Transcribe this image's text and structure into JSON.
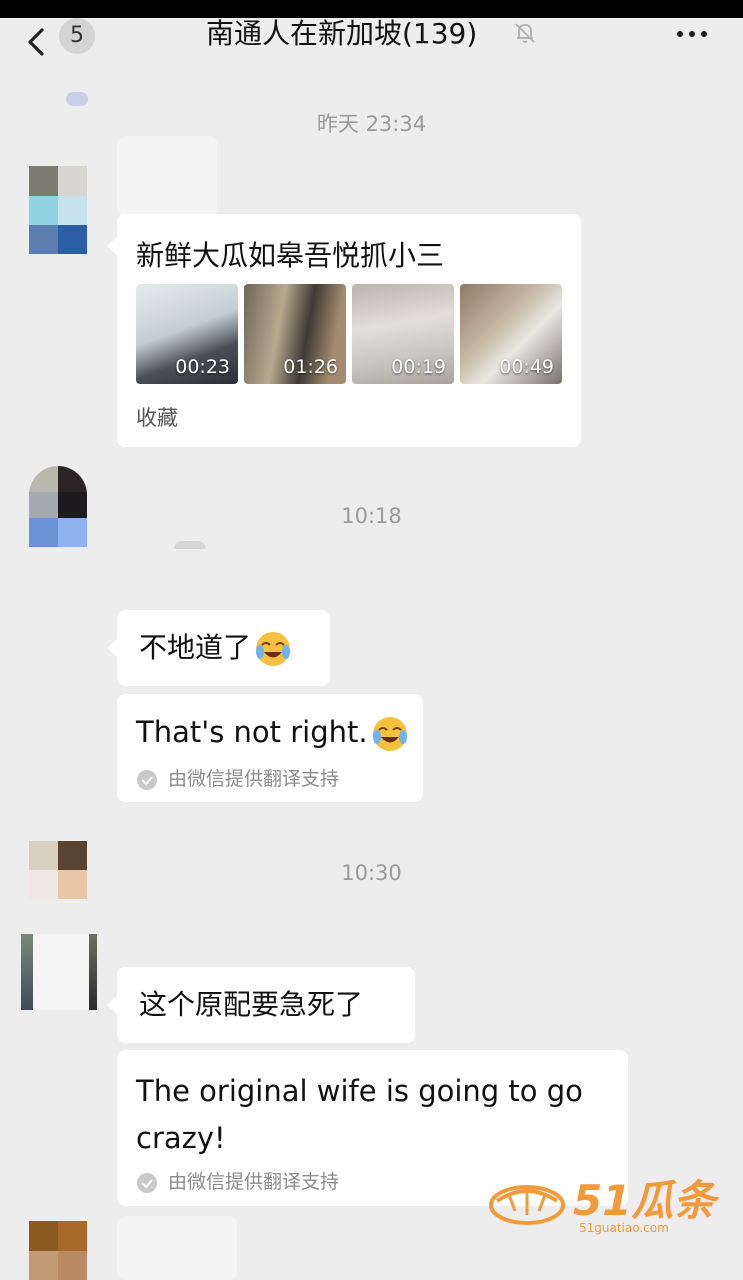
{
  "header": {
    "unread_count": "5",
    "title": "南通人在新加坡(139)",
    "icons": [
      "back-chevron-icon",
      "mute-bell-icon",
      "more-dots-icon"
    ]
  },
  "messages": [
    {
      "timestamp": "昨天 23:34",
      "card": {
        "title": "新鲜大瓜如皋吾悦抓小三",
        "videos": [
          {
            "duration": "00:23"
          },
          {
            "duration": "01:26"
          },
          {
            "duration": "00:19"
          },
          {
            "duration": "00:49"
          }
        ],
        "source": "收藏"
      }
    },
    {
      "timestamp": "10:18",
      "text": "不地道了",
      "translation": "That's not right.",
      "translation_note": "由微信提供翻译支持"
    },
    {
      "timestamp": "10:30",
      "text": "这个原配要急死了",
      "translation_line1": "The original wife is going to go",
      "translation_line2": "crazy!",
      "translation_note": "由微信提供翻译支持"
    }
  ],
  "watermark": {
    "brand": "51瓜条",
    "url": "51guatiao.com"
  },
  "colors": {
    "background": "#ededed",
    "bubble": "#ffffff",
    "timestamp": "#9a9a9a",
    "watermark": "#f29a3a"
  }
}
